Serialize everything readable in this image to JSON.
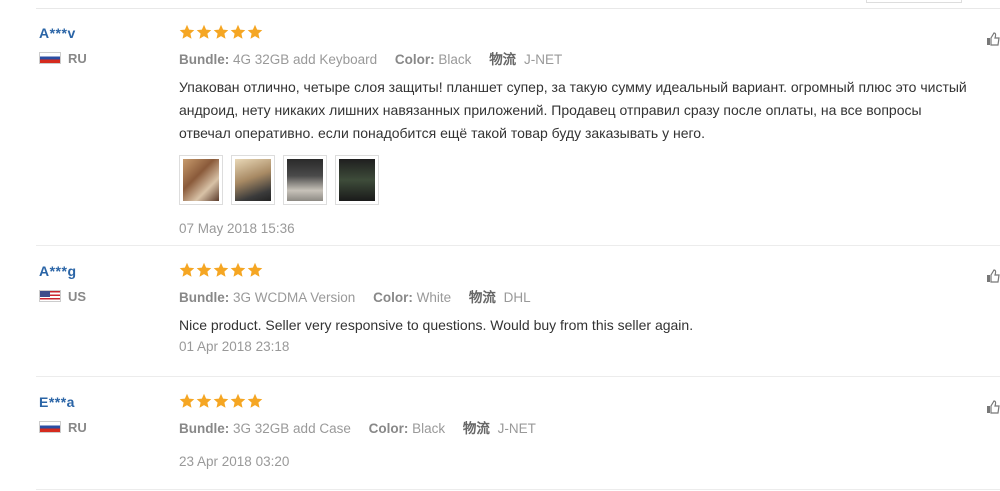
{
  "labels": {
    "bundle": "Bundle:",
    "color": "Color:",
    "shipping": "物流"
  },
  "colors": {
    "username": "#2a64a6",
    "star": "#f5a623",
    "muted": "#999999"
  },
  "reviews": [
    {
      "user": "A***v",
      "country": "RU",
      "flag": "russia-flag",
      "rating": 5,
      "bundle": "4G 32GB add Keyboard",
      "color": "Black",
      "shipping": "J-NET",
      "text": "Упакован отлично, четыре слоя защиты! планшет супер, за такую сумму идеальный вариант. огромный плюс это чистый андроид, нету никаких лишних навязанных приложений. Продавец отправил сразу после оплаты, на все вопросы отвечал оперативно. если понадобится ещё такой товар буду заказывать у него.",
      "photos": 4,
      "date": "07 May 2018 15:36"
    },
    {
      "user": "A***g",
      "country": "US",
      "flag": "usa-flag",
      "rating": 5,
      "bundle": "3G WCDMA Version",
      "color": "White",
      "shipping": "DHL",
      "text": "Nice product. Seller very responsive to questions. Would buy from this seller again.",
      "photos": 0,
      "date": "01 Apr 2018 23:18"
    },
    {
      "user": "E***a",
      "country": "RU",
      "flag": "russia-flag",
      "rating": 5,
      "bundle": "3G 32GB add Case",
      "color": "Black",
      "shipping": "J-NET",
      "text": "",
      "photos": 0,
      "date": "23 Apr 2018 03:20"
    }
  ]
}
